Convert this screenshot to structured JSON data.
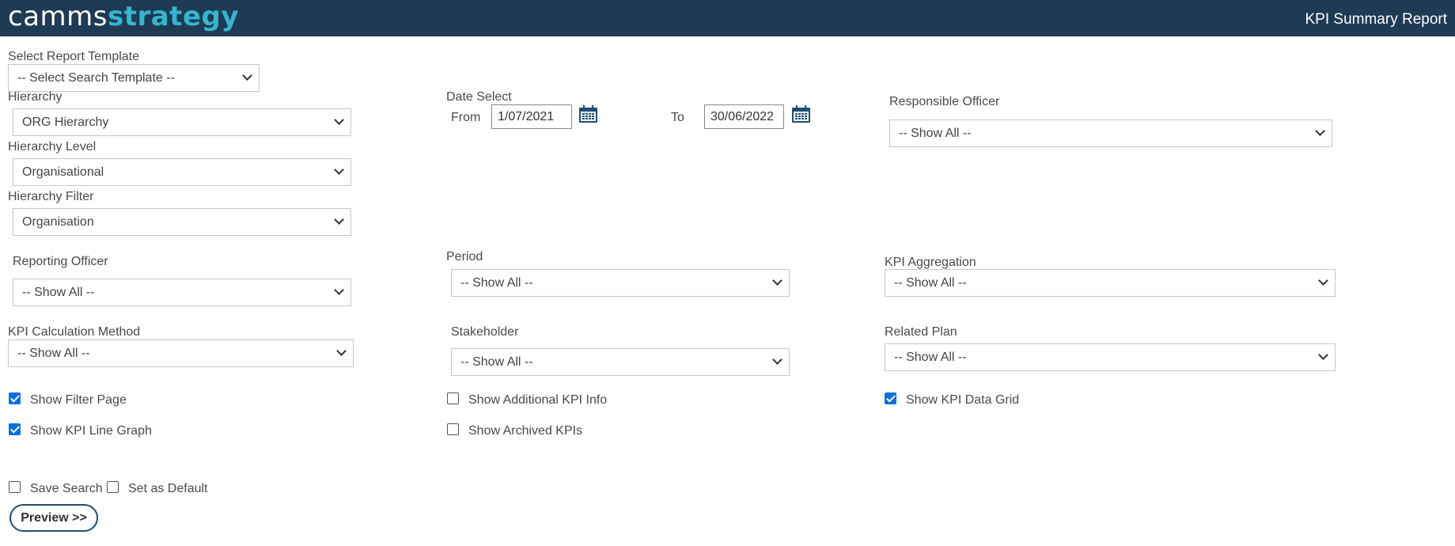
{
  "header": {
    "logo_part1": "camms",
    "logo_part2": "strategy",
    "report_title": "KPI Summary Report"
  },
  "template": {
    "label": "Select Report Template",
    "value": "-- Select Search Template --"
  },
  "hierarchy": {
    "label": "Hierarchy",
    "value": "ORG Hierarchy"
  },
  "hierarchy_level": {
    "label": "Hierarchy Level",
    "value": "Organisational"
  },
  "hierarchy_filter": {
    "label": "Hierarchy Filter",
    "value": "Organisation"
  },
  "date_select": {
    "label": "Date Select",
    "from_label": "From",
    "from_value": "1/07/2021",
    "to_label": "To",
    "to_value": "30/06/2022"
  },
  "responsible_officer": {
    "label": "Responsible Officer",
    "value": "-- Show All --"
  },
  "reporting_officer": {
    "label": "Reporting Officer",
    "value": "-- Show All --"
  },
  "period": {
    "label": "Period",
    "value": "-- Show All --"
  },
  "kpi_aggregation": {
    "label": "KPI Aggregation",
    "value": "-- Show All --"
  },
  "kpi_calc_method": {
    "label": "KPI Calculation Method",
    "value": "-- Show All --"
  },
  "stakeholder": {
    "label": "Stakeholder",
    "value": "-- Show All --"
  },
  "related_plan": {
    "label": "Related Plan",
    "value": "-- Show All --"
  },
  "checkboxes": {
    "show_filter_page": {
      "label": "Show Filter Page",
      "checked": true
    },
    "show_additional_kpi_info": {
      "label": "Show Additional KPI Info",
      "checked": false
    },
    "show_kpi_data_grid": {
      "label": "Show KPI Data Grid",
      "checked": true
    },
    "show_kpi_line_graph": {
      "label": "Show KPI Line Graph",
      "checked": true
    },
    "show_archived_kpis": {
      "label": "Show Archived KPIs",
      "checked": false
    },
    "save_search": {
      "label": "Save Search",
      "checked": false
    },
    "set_as_default": {
      "label": "Set as Default",
      "checked": false
    }
  },
  "preview_button": "Preview >>",
  "colors": {
    "header_bg": "#1f3a54",
    "logo_accent": "#35b6cc",
    "checkbox_checked": "#0a6fe0",
    "button_border": "#1f4d74"
  }
}
